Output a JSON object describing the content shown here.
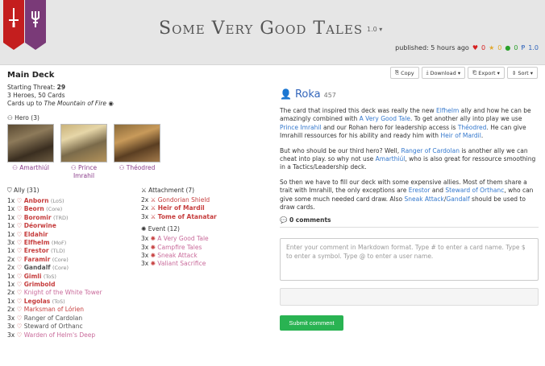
{
  "header": {
    "title": "Some Very Good Tales",
    "version": "1.0 ▾",
    "published": "published: 5 hours ago",
    "likes": "0",
    "favorites": "0",
    "comments": "0",
    "version_count": "1.0"
  },
  "toolbar": {
    "copy": "Copy",
    "download": "Download ▾",
    "export": "Export ▾",
    "sort": "Sort ▾"
  },
  "deck": {
    "title": "Main Deck",
    "starting_threat_label": "Starting Threat:",
    "starting_threat": "29",
    "heroes_cards": "3 Heroes, 50 Cards",
    "cards_up_to_label": "Cards up to",
    "cards_up_to": "The Mountain of Fire"
  },
  "hero_section": "Hero (3)",
  "heroes": [
    {
      "name": "Amarthiúl"
    },
    {
      "name": "Prince Imrahil"
    },
    {
      "name": "Théodred"
    }
  ],
  "ally_section": "Ally (31)",
  "allies": [
    {
      "qty": "1x",
      "name": "Anborn",
      "pack": "(LoS)",
      "style": "bold"
    },
    {
      "qty": "1x",
      "name": "Beorn",
      "pack": "(Core)",
      "style": "bold"
    },
    {
      "qty": "1x",
      "name": "Boromir",
      "pack": "(TRD)",
      "style": "bold"
    },
    {
      "qty": "1x",
      "name": "Déorwine",
      "pack": "",
      "style": "bold"
    },
    {
      "qty": "1x",
      "name": "Eldahir",
      "pack": "",
      "style": "bold"
    },
    {
      "qty": "3x",
      "name": "Elfhelm",
      "pack": "(MoF)",
      "style": "bold"
    },
    {
      "qty": "1x",
      "name": "Erestor",
      "pack": "(TLD)",
      "style": "bold"
    },
    {
      "qty": "2x",
      "name": "Faramir",
      "pack": "(Core)",
      "style": "bold"
    },
    {
      "qty": "2x",
      "name": "Gandalf",
      "pack": "(Core)",
      "style": "neutral-b"
    },
    {
      "qty": "1x",
      "name": "Gimli",
      "pack": "(ToS)",
      "style": "bold"
    },
    {
      "qty": "1x",
      "name": "Grimbold",
      "pack": "",
      "style": "bold"
    },
    {
      "qty": "2x",
      "name": "Knight of the White Tower",
      "pack": "",
      "style": "light"
    },
    {
      "qty": "1x",
      "name": "Legolas",
      "pack": "(ToS)",
      "style": "bold"
    },
    {
      "qty": "2x",
      "name": "Marksman of Lórien",
      "pack": "",
      "style": "plain"
    },
    {
      "qty": "3x",
      "name": "Ranger of Cardolan",
      "pack": "",
      "style": "neutral"
    },
    {
      "qty": "3x",
      "name": "Steward of Orthanc",
      "pack": "",
      "style": "neutral"
    },
    {
      "qty": "3x",
      "name": "Warden of Helm's Deep",
      "pack": "",
      "style": "light"
    }
  ],
  "attachment_section": "Attachment (7)",
  "attachments": [
    {
      "qty": "2x",
      "name": "Gondorian Shield",
      "style": "plain"
    },
    {
      "qty": "2x",
      "name": "Heir of Mardil",
      "style": "bold"
    },
    {
      "qty": "3x",
      "name": "Tome of Atanatar",
      "style": "bold"
    }
  ],
  "event_section": "Event (12)",
  "events": [
    {
      "qty": "3x",
      "name": "A Very Good Tale",
      "style": "light"
    },
    {
      "qty": "3x",
      "name": "Campfire Tales",
      "style": "light"
    },
    {
      "qty": "3x",
      "name": "Sneak Attack",
      "style": "light"
    },
    {
      "qty": "3x",
      "name": "Valiant Sacrifice",
      "style": "light"
    }
  ],
  "author": {
    "name": "Roka",
    "reputation": "457"
  },
  "description": {
    "p1": [
      {
        "t": "The card that inspired this deck was really the new "
      },
      {
        "t": "Elfhelm",
        "link": true
      },
      {
        "t": " ally and how he can be amazingly combined with "
      },
      {
        "t": "A Very Good Tale",
        "link": true
      },
      {
        "t": ". To get another ally into play we use "
      },
      {
        "t": "Prince Imrahil",
        "link": true
      },
      {
        "t": " and our Rohan hero for leadership access is "
      },
      {
        "t": "Théodred",
        "link": true
      },
      {
        "t": ". He can give Imrahill ressources for his ability and ready him with "
      },
      {
        "t": "Heir of Mardil",
        "link": true
      },
      {
        "t": "."
      }
    ],
    "p2": [
      {
        "t": "But who should be our third hero? Well, "
      },
      {
        "t": "Ranger of Cardolan",
        "link": true
      },
      {
        "t": " is another ally we can cheat into play. so why not use "
      },
      {
        "t": "Amarthiúl",
        "link": true
      },
      {
        "t": ", who is also great for ressource smoothing in a Tactics/Leadership deck."
      }
    ],
    "p3": [
      {
        "t": "So then we have to fill our deck with some expensive allies. Most of them share a trait with Imrahill, the only exceptions are "
      },
      {
        "t": "Erestor",
        "link": true
      },
      {
        "t": " and "
      },
      {
        "t": "Steward of Orthanc",
        "link": true
      },
      {
        "t": ", who can give some much needed card draw. Also "
      },
      {
        "t": "Sneak Attack",
        "link": true
      },
      {
        "t": "/"
      },
      {
        "t": "Gandalf",
        "link": true
      },
      {
        "t": " should be used to draw cards."
      }
    ]
  },
  "comments": {
    "title": "0 comments",
    "placeholder": "Enter your comment in Markdown format. Type # to enter a card name. Type $ to enter a symbol. Type @ to enter a user name.",
    "submit": "Submit comment"
  },
  "colors": {
    "banner_red": "#c41e1e",
    "banner_purple": "#7a3a78",
    "link": "#3377cc",
    "card_red": "#c63d3d",
    "submit_green": "#29b352"
  }
}
